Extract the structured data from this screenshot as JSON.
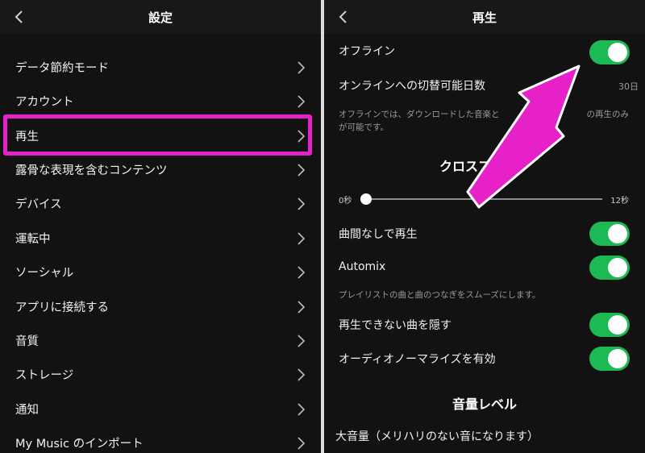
{
  "left": {
    "title": "設定",
    "items": [
      {
        "label": "データ節約モード"
      },
      {
        "label": "アカウント"
      },
      {
        "label": "再生"
      },
      {
        "label": "露骨な表現を含むコンテンツ"
      },
      {
        "label": "デバイス"
      },
      {
        "label": "運転中"
      },
      {
        "label": "ソーシャル"
      },
      {
        "label": "アプリに接続する"
      },
      {
        "label": "音質"
      },
      {
        "label": "ストレージ"
      },
      {
        "label": "通知"
      },
      {
        "label": "My Music のインポート"
      }
    ]
  },
  "right": {
    "title": "再生",
    "offline_label": "オフライン",
    "offline_on": true,
    "switch_days_label": "オンラインへの切替可能日数",
    "switch_days_value": "30日",
    "offline_note_line1": "オフラインでは、ダウンロードした音楽と",
    "offline_note_line1_end": "の再生のみ",
    "offline_note_line2": "が可能です。",
    "crossfade_title": "クロスフェード",
    "crossfade_min": "0秒",
    "crossfade_max": "12秒",
    "crossfade_value": 0,
    "gapless_label": "曲間なしで再生",
    "automix_label": "Automix",
    "automix_note": "プレイリストの曲と曲のつなぎをスムーズにします。",
    "hide_unplayable_label": "再生できない曲を隠す",
    "normalize_label": "オーディオノーマライズを有効",
    "volume_title": "音量レベル",
    "volume_option": "大音量（メリハリのない音になります）"
  },
  "colors": {
    "accent_green": "#1db954",
    "highlight_magenta": "#e621c8",
    "background": "#121212"
  }
}
